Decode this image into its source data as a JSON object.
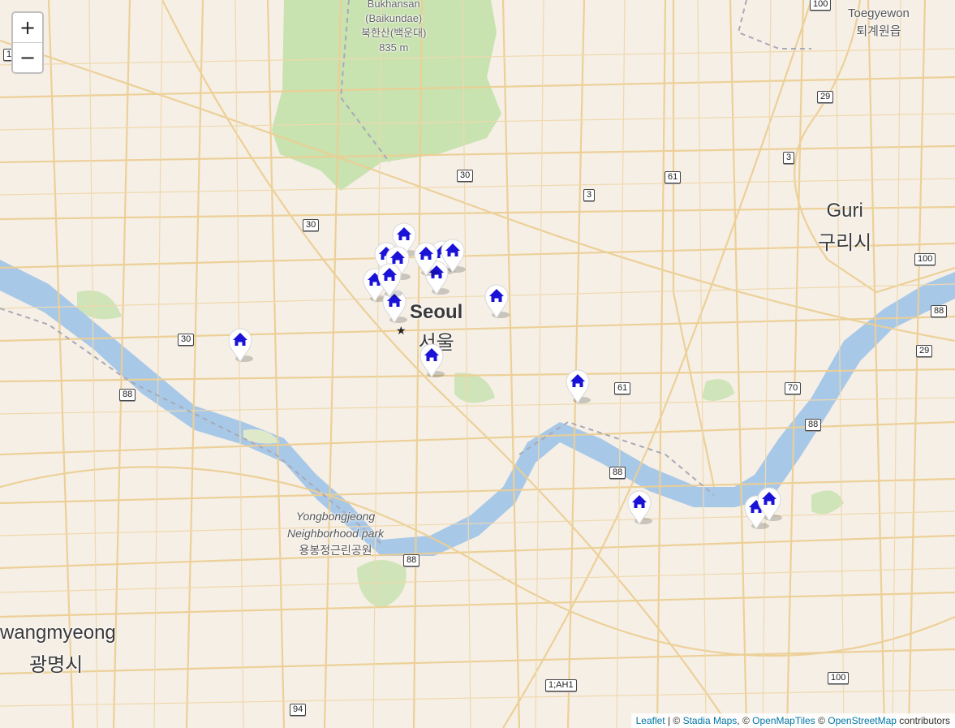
{
  "zoom": {
    "in_label": "+",
    "out_label": "−"
  },
  "places": {
    "bukhansan_en": "Bukhansan",
    "bukhansan_alt": "(Baikundae)",
    "bukhansan_ko": "북한산(백운대)",
    "bukhansan_elev": "835 m",
    "toegyewon_en": "Toegyewon",
    "toegyewon_ko": "퇴계원읍",
    "seoul_en": "Seoul",
    "seoul_ko": "서울",
    "guri_en": "Guri",
    "guri_ko": "구리시",
    "gwangmyeong_en": "wangmyeong",
    "gwangmyeong_ko": "광명시",
    "yongbong_en1": "Yongbongjeong",
    "yongbong_en2": "Neighborhood park",
    "yongbong_ko": "용봉정근린공원"
  },
  "road_shields": [
    "100",
    "1",
    "29",
    "3",
    "30",
    "61",
    "3",
    "30",
    "100",
    "88",
    "30",
    "29",
    "88",
    "61",
    "70",
    "88",
    "88",
    "88",
    "1;AH1",
    "94",
    "100"
  ],
  "markers": [
    {
      "name": "house-marker",
      "icon": "home-icon"
    },
    {
      "name": "house-marker",
      "icon": "home-icon"
    },
    {
      "name": "house-marker",
      "icon": "home-icon"
    },
    {
      "name": "house-marker",
      "icon": "home-icon"
    },
    {
      "name": "house-marker",
      "icon": "home-icon"
    },
    {
      "name": "house-marker",
      "icon": "home-icon"
    },
    {
      "name": "house-marker",
      "icon": "home-icon"
    },
    {
      "name": "house-marker",
      "icon": "home-icon"
    },
    {
      "name": "house-marker",
      "icon": "home-icon"
    },
    {
      "name": "house-marker",
      "icon": "home-icon"
    },
    {
      "name": "house-marker",
      "icon": "home-icon"
    },
    {
      "name": "house-marker",
      "icon": "home-icon"
    },
    {
      "name": "house-marker",
      "icon": "home-icon"
    },
    {
      "name": "house-marker",
      "icon": "home-icon"
    },
    {
      "name": "house-marker",
      "icon": "home-icon"
    },
    {
      "name": "house-marker",
      "icon": "home-icon"
    },
    {
      "name": "house-marker",
      "icon": "home-icon"
    }
  ],
  "colors": {
    "marker_icon": "#1a12d6",
    "water": "#a8c8e8",
    "road": "#e8c98a",
    "park": "#c8e2b0"
  },
  "attribution": {
    "leaflet": "Leaflet",
    "sep1": " | © ",
    "stadia": "Stadia Maps",
    "sep2": ", © ",
    "omt": "OpenMapTiles",
    "sep3": " © ",
    "osm": "OpenStreetMap",
    "tail": " contributors"
  }
}
